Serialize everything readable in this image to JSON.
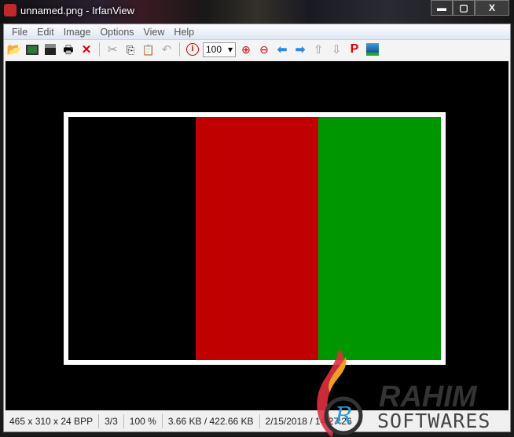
{
  "window": {
    "title": "unnamed.png - IrfanView",
    "minimize": "▬",
    "maximize": "▢",
    "close": "X"
  },
  "menu": [
    "File",
    "Edit",
    "Image",
    "Options",
    "View",
    "Help"
  ],
  "toolbar": {
    "zoom_value": "100",
    "zoom_arrow": "▾"
  },
  "image": {
    "colors": [
      "#000000",
      "#c00000",
      "#009600"
    ]
  },
  "status": [
    "465 x 310 x 24 BPP",
    "3/3",
    "100 %",
    "3.66 KB / 422.66 KB",
    "2/15/2018 / 14:27:26"
  ],
  "watermark": {
    "line1": "RAHIM",
    "line2": "SOFTWARES"
  }
}
